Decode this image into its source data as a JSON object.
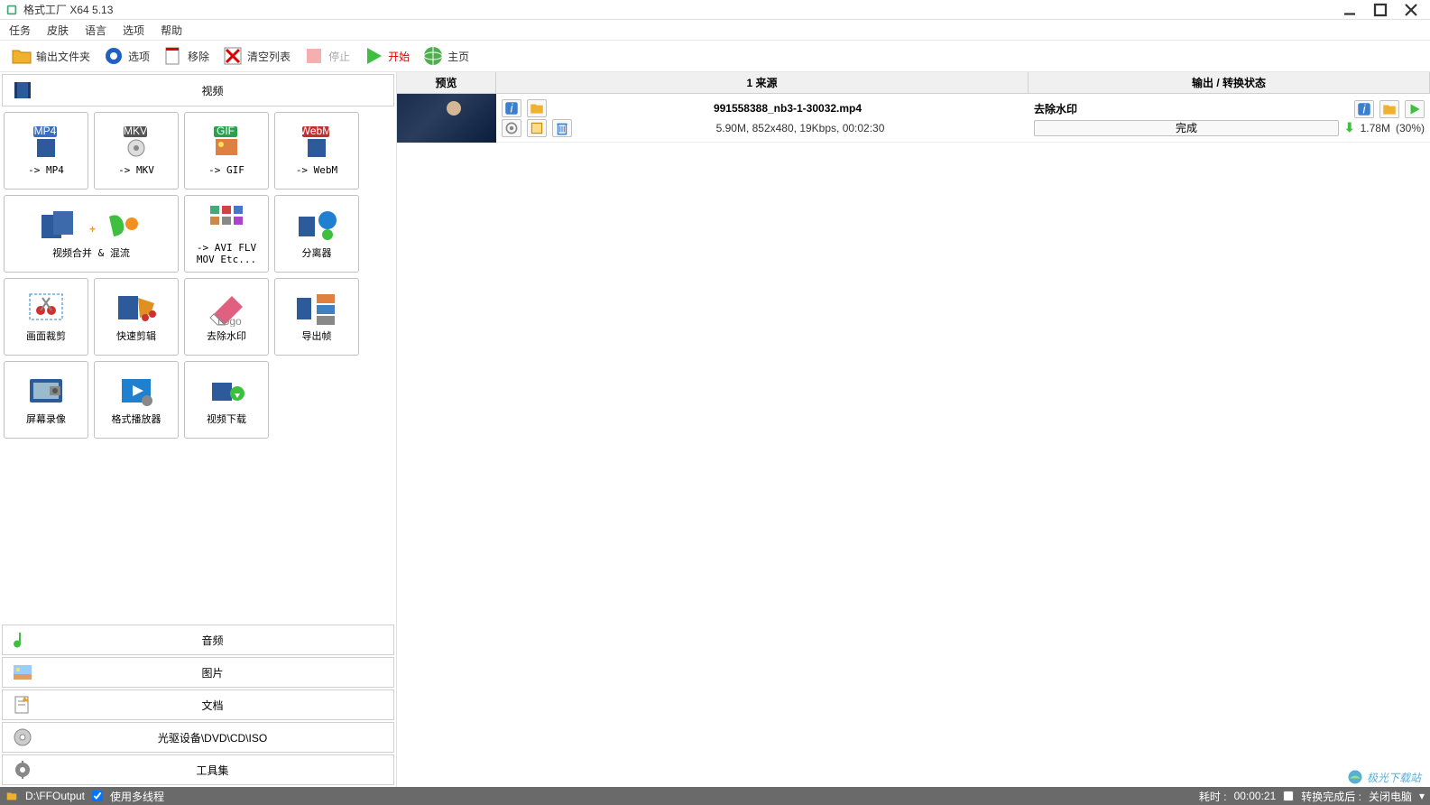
{
  "window": {
    "title": "格式工厂 X64 5.13"
  },
  "menu": {
    "task": "任务",
    "skin": "皮肤",
    "lang": "语言",
    "options": "选项",
    "help": "帮助"
  },
  "toolbar": {
    "output_folder": "输出文件夹",
    "options": "选项",
    "remove": "移除",
    "clear": "清空列表",
    "stop": "停止",
    "start": "开始",
    "homepage": "主页"
  },
  "categories": {
    "video": "视频",
    "audio": "音频",
    "picture": "图片",
    "document": "文档",
    "disc": "光驱设备\\DVD\\CD\\ISO",
    "toolset": "工具集"
  },
  "grid": {
    "mp4": "-> MP4",
    "mkv": "-> MKV",
    "gif": "-> GIF",
    "webm": "-> WebM",
    "merge": "视频合并 & 混流",
    "avi": "-> AVI FLV MOV Etc...",
    "splitter": "分离器",
    "crop": "画面裁剪",
    "quick_clip": "快速剪辑",
    "remove_wm": "去除水印",
    "export_frame": "导出帧",
    "recorder": "屏幕录像",
    "player": "格式播放器",
    "downloader": "视频下载"
  },
  "table": {
    "preview": "预览",
    "source_count": "1",
    "source_label": "来源",
    "status": "输出 / 转换状态"
  },
  "row": {
    "filename": "991558388_nb3-1-30032.mp4",
    "meta": "5.90M, 852x480, 19Kbps, 00:02:30",
    "operation": "去除水印",
    "progress_label": "完成",
    "out_size": "1.78M",
    "percent": "(30%)"
  },
  "status": {
    "output_path": "D:\\FFOutput",
    "multithread": "使用多线程",
    "elapsed_label": "耗时 :",
    "elapsed": "00:00:21",
    "after_label": "转换完成后 :",
    "after_action": "关闭电脑"
  },
  "watermark": "极光下载站"
}
